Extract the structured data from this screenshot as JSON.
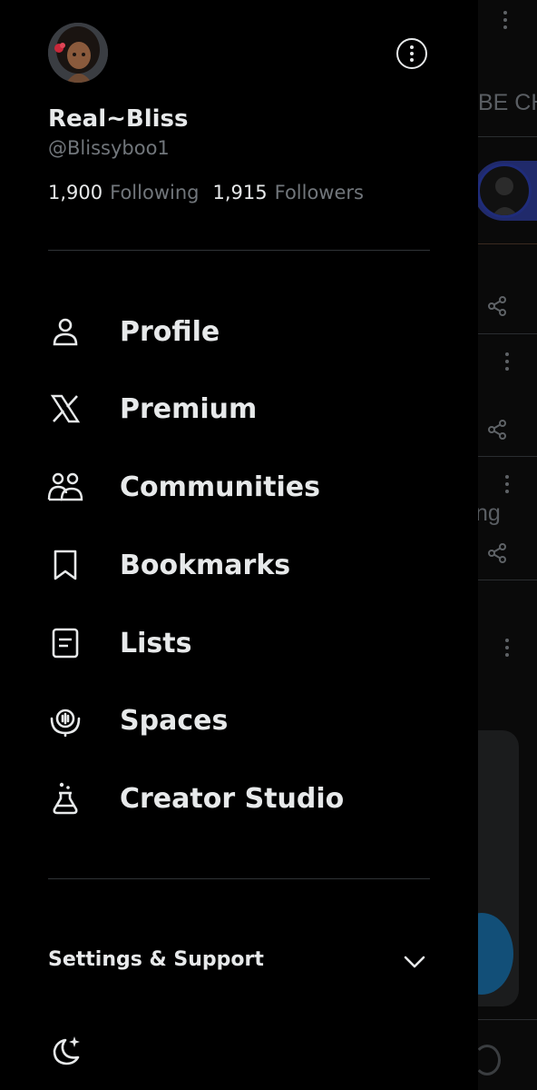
{
  "profile": {
    "display_name": "Real~Bliss",
    "handle": "@Blissyboo1",
    "following_count": "1,900",
    "following_label": "Following",
    "followers_count": "1,915",
    "followers_label": "Followers"
  },
  "menu": {
    "items": [
      {
        "label": "Profile",
        "icon": "person-icon"
      },
      {
        "label": "Premium",
        "icon": "x-logo-icon"
      },
      {
        "label": "Communities",
        "icon": "communities-icon"
      },
      {
        "label": "Bookmarks",
        "icon": "bookmark-icon"
      },
      {
        "label": "Lists",
        "icon": "list-icon"
      },
      {
        "label": "Spaces",
        "icon": "spaces-icon"
      },
      {
        "label": "Creator Studio",
        "icon": "flask-icon"
      }
    ]
  },
  "settings": {
    "label": "Settings & Support",
    "icon": "chevron-down-icon"
  },
  "theme": {
    "icon": "moon-sparkle-icon"
  },
  "background": {
    "header_fragment": "BE CH",
    "post_fragment": "ng"
  },
  "colors": {
    "background": "#000000",
    "text_primary": "#e7e9ea",
    "text_secondary": "#71767b",
    "divider": "#2f3336",
    "fab_blue": "#124f78"
  }
}
